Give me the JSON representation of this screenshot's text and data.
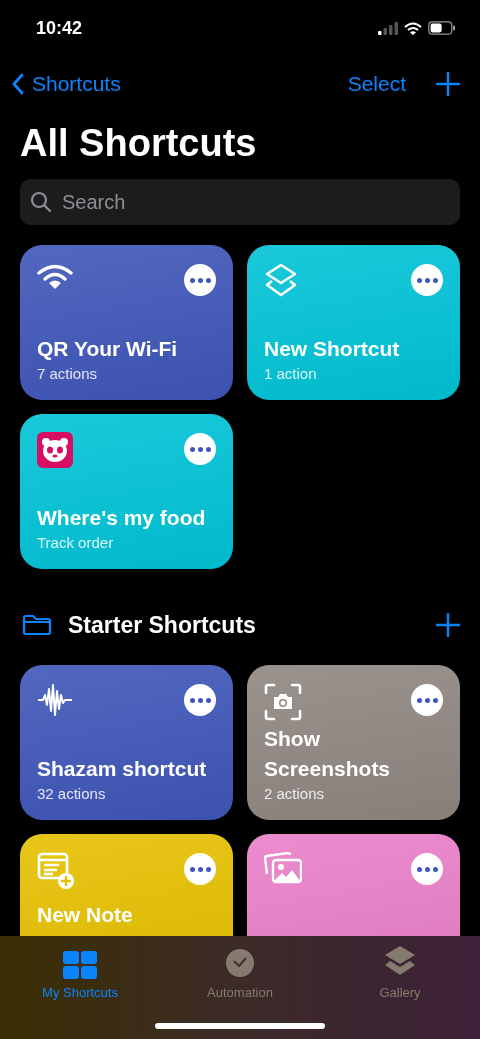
{
  "status_bar": {
    "time": "10:42"
  },
  "nav": {
    "back": "Shortcuts",
    "select": "Select"
  },
  "title": "All Shortcuts",
  "search": {
    "placeholder": "Search"
  },
  "shortcuts": [
    {
      "title": "QR Your Wi-Fi",
      "subtitle": "7 actions",
      "color": "#3f56b8"
    },
    {
      "title": "New Shortcut",
      "subtitle": "1 action",
      "color": "#00c3d6"
    },
    {
      "title": "Where's my food",
      "subtitle": "Track order",
      "color": "#00c3d6"
    }
  ],
  "folder": {
    "title": "Starter Shortcuts"
  },
  "starter": [
    {
      "title": "Shazam shortcut",
      "subtitle": "32 actions",
      "color": "#3f56b8"
    },
    {
      "title": "Show Screenshots",
      "subtitle": "2 actions",
      "color": "#8f8680"
    },
    {
      "title": "New Note",
      "color": "#e6c000"
    },
    {
      "color": "#e97fc8"
    }
  ],
  "tabs": [
    {
      "label": "My Shortcuts",
      "selected": true
    },
    {
      "label": "Automation",
      "selected": false
    },
    {
      "label": "Gallery",
      "selected": false
    }
  ]
}
